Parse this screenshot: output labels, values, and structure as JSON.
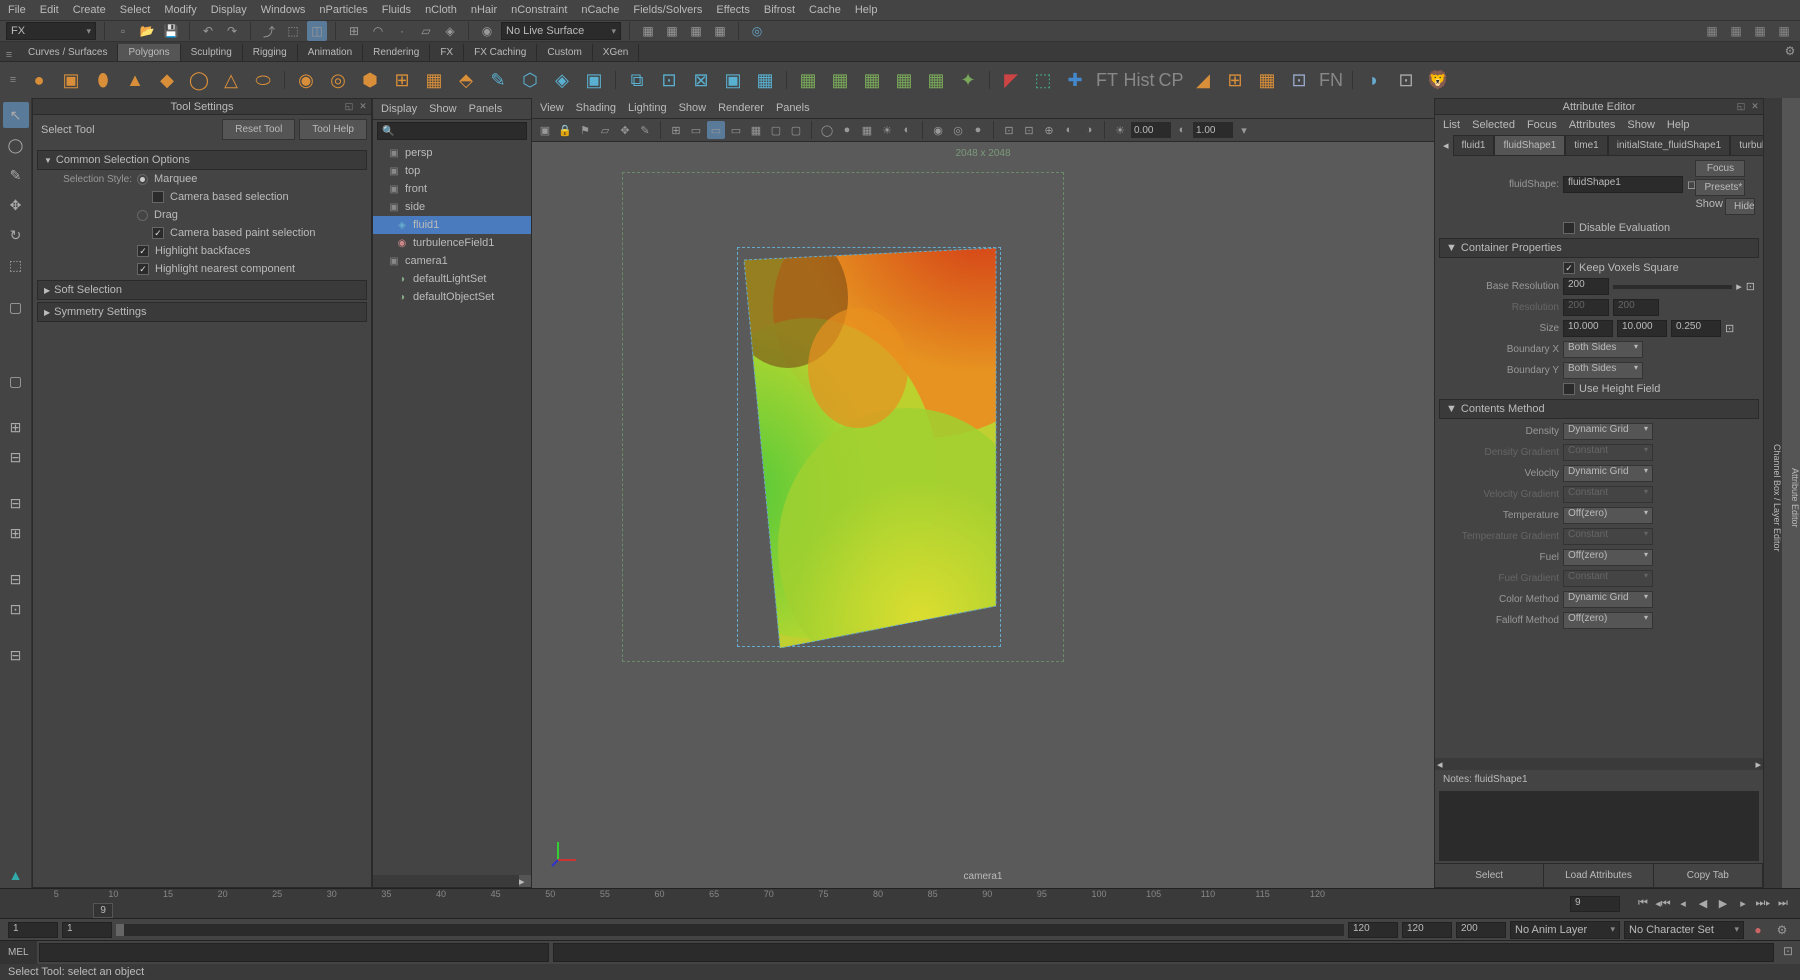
{
  "menubar": [
    "File",
    "Edit",
    "Create",
    "Select",
    "Modify",
    "Display",
    "Windows",
    "nParticles",
    "Fluids",
    "nCloth",
    "nHair",
    "nConstraint",
    "nCache",
    "Fields/Solvers",
    "Effects",
    "Bifrost",
    "Cache",
    "Help"
  ],
  "workspace_dropdown": "FX",
  "live_surface": "No Live Surface",
  "shelf_tabs": [
    "Curves / Surfaces",
    "Polygons",
    "Sculpting",
    "Rigging",
    "Animation",
    "Rendering",
    "FX",
    "FX Caching",
    "Custom",
    "XGen"
  ],
  "shelf_active": "Polygons",
  "tool_settings": {
    "title": "Tool Settings",
    "tool_name": "Select Tool",
    "reset_btn": "Reset Tool",
    "help_btn": "Tool Help",
    "sections": {
      "common": "Common Selection Options",
      "soft": "Soft Selection",
      "symmetry": "Symmetry Settings"
    },
    "sel_style_label": "Selection Style:",
    "marquee": "Marquee",
    "camera_sel": "Camera based selection",
    "drag": "Drag",
    "camera_paint": "Camera based paint selection",
    "highlight_back": "Highlight backfaces",
    "highlight_near": "Highlight nearest component"
  },
  "outliner": {
    "menus": [
      "Display",
      "Show",
      "Panels"
    ],
    "items": [
      {
        "icon": "▣",
        "label": "persp",
        "type": "cam"
      },
      {
        "icon": "▣",
        "label": "top",
        "type": "cam"
      },
      {
        "icon": "▣",
        "label": "front",
        "type": "cam"
      },
      {
        "icon": "▣",
        "label": "side",
        "type": "cam"
      },
      {
        "icon": "◈",
        "label": "fluid1",
        "type": "fluid",
        "sel": true
      },
      {
        "icon": "◉",
        "label": "turbulenceField1",
        "type": "field"
      },
      {
        "icon": "▣",
        "label": "camera1",
        "type": "cam"
      },
      {
        "icon": "◑",
        "label": "defaultLightSet",
        "type": "set"
      },
      {
        "icon": "◑",
        "label": "defaultObjectSet",
        "type": "set"
      }
    ]
  },
  "viewport": {
    "menus": [
      "View",
      "Shading",
      "Lighting",
      "Show",
      "Renderer",
      "Panels"
    ],
    "resolution": "2048 x 2048",
    "camera": "camera1",
    "num1": "0.00",
    "num2": "1.00"
  },
  "attr_editor": {
    "title": "Attribute Editor",
    "menus": [
      "List",
      "Selected",
      "Focus",
      "Attributes",
      "Show",
      "Help"
    ],
    "tabs": [
      "fluid1",
      "fluidShape1",
      "time1",
      "initialState_fluidShape1",
      "turbul"
    ],
    "active_tab": "fluidShape1",
    "shape_label": "fluidShape:",
    "shape_value": "fluidShape1",
    "focus_btn": "Focus",
    "presets_btn": "Presets*",
    "show_label": "Show",
    "hide_btn": "Hide",
    "disable_eval": "Disable Evaluation",
    "container_section": "Container Properties",
    "keep_voxels": "Keep Voxels Square",
    "base_res_label": "Base Resolution",
    "base_res_val": "200",
    "resolution_label": "Resolution",
    "res_x": "200",
    "res_y": "200",
    "size_label": "Size",
    "size_x": "10.000",
    "size_y": "10.000",
    "size_z": "0.250",
    "boundary_x_label": "Boundary X",
    "boundary_x": "Both Sides",
    "boundary_y_label": "Boundary Y",
    "boundary_y": "Both Sides",
    "use_height": "Use Height Field",
    "contents_section": "Contents Method",
    "density_label": "Density",
    "density_val": "Dynamic Grid",
    "density_grad_label": "Density Gradient",
    "density_grad": "Constant",
    "velocity_label": "Velocity",
    "velocity_val": "Dynamic Grid",
    "velocity_grad_label": "Velocity Gradient",
    "velocity_grad": "Constant",
    "temp_label": "Temperature",
    "temp_val": "Off(zero)",
    "temp_grad_label": "Temperature Gradient",
    "temp_grad": "Constant",
    "fuel_label": "Fuel",
    "fuel_val": "Off(zero)",
    "fuel_grad_label": "Fuel Gradient",
    "fuel_grad": "Constant",
    "color_method_label": "Color Method",
    "color_method": "Dynamic Grid",
    "falloff_label": "Falloff Method",
    "falloff_val": "Off(zero)",
    "notes_label": "Notes: fluidShape1",
    "footer_btns": [
      "Select",
      "Load Attributes",
      "Copy Tab"
    ]
  },
  "timeline": {
    "ticks": [
      5,
      10,
      15,
      20,
      25,
      30,
      35,
      40,
      45,
      50,
      55,
      60,
      65,
      70,
      75,
      80,
      85,
      90,
      95,
      100,
      105,
      110,
      115,
      120
    ],
    "current": 9,
    "current_box": "9"
  },
  "range": {
    "start": "1",
    "range_start": "1",
    "range_end": "120",
    "end": "120",
    "fps": "200",
    "anim_layer": "No Anim Layer",
    "char_set": "No Character Set"
  },
  "cmd_label": "MEL",
  "status_text": "Select Tool: select an object"
}
